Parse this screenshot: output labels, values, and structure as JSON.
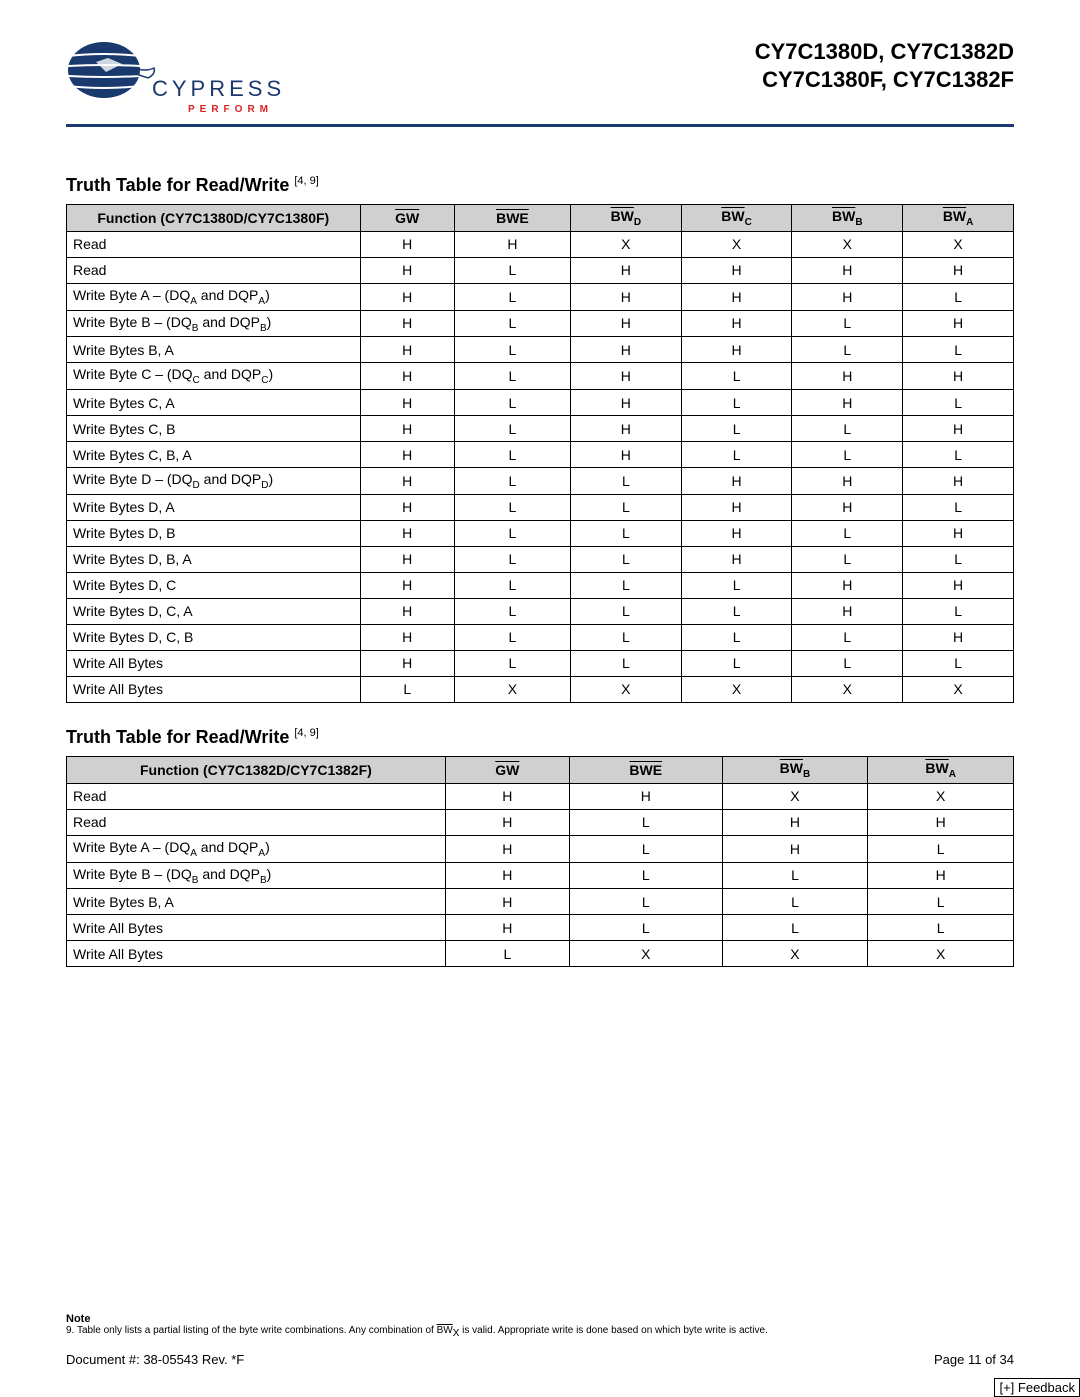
{
  "header": {
    "logo_text": "CYPRESS",
    "logo_tagline": "PERFORM",
    "part_line1": "CY7C1380D, CY7C1382D",
    "part_line2": "CY7C1380F, CY7C1382F"
  },
  "section1": {
    "title": "Truth Table for Read/Write ",
    "footnote_ref": "[4, 9]",
    "headers": {
      "function": "Function (CY7C1380D/CY7C1380F)",
      "gw": "GW",
      "bwe": "BWE",
      "bwd": "BW",
      "bwd_sub": "D",
      "bwc": "BW",
      "bwc_sub": "C",
      "bwb": "BW",
      "bwb_sub": "B",
      "bwa": "BW",
      "bwa_sub": "A"
    },
    "rows": [
      {
        "fn": "Read",
        "gw": "H",
        "bwe": "H",
        "bwd": "X",
        "bwc": "X",
        "bwb": "X",
        "bwa": "X",
        "fn_html": "Read"
      },
      {
        "fn": "Read",
        "gw": "H",
        "bwe": "L",
        "bwd": "H",
        "bwc": "H",
        "bwb": "H",
        "bwa": "H",
        "fn_html": "Read"
      },
      {
        "fn": "Write Byte A – (DQA and DQPA)",
        "gw": "H",
        "bwe": "L",
        "bwd": "H",
        "bwc": "H",
        "bwb": "H",
        "bwa": "L",
        "fn_html": "Write Byte A  – (DQ<sub>A</sub> and DQP<sub>A</sub>)"
      },
      {
        "fn": "Write Byte B – (DQB and DQPB)",
        "gw": "H",
        "bwe": "L",
        "bwd": "H",
        "bwc": "H",
        "bwb": "L",
        "bwa": "H",
        "fn_html": "Write Byte B – (DQ<sub>B</sub> and DQP<sub>B</sub>)"
      },
      {
        "fn": "Write Bytes B, A",
        "gw": "H",
        "bwe": "L",
        "bwd": "H",
        "bwc": "H",
        "bwb": "L",
        "bwa": "L",
        "fn_html": "Write Bytes B, A"
      },
      {
        "fn": "Write Byte C – (DQC and DQPC)",
        "gw": "H",
        "bwe": "L",
        "bwd": "H",
        "bwc": "L",
        "bwb": "H",
        "bwa": "H",
        "fn_html": "Write Byte C – (DQ<sub>C</sub> and DQP<sub>C</sub>)"
      },
      {
        "fn": "Write Bytes C, A",
        "gw": "H",
        "bwe": "L",
        "bwd": "H",
        "bwc": "L",
        "bwb": "H",
        "bwa": "L",
        "fn_html": "Write Bytes C, A"
      },
      {
        "fn": "Write Bytes C, B",
        "gw": "H",
        "bwe": "L",
        "bwd": "H",
        "bwc": "L",
        "bwb": "L",
        "bwa": "H",
        "fn_html": "Write Bytes C, B"
      },
      {
        "fn": "Write Bytes C, B, A",
        "gw": "H",
        "bwe": "L",
        "bwd": "H",
        "bwc": "L",
        "bwb": "L",
        "bwa": "L",
        "fn_html": "Write Bytes C, B, A"
      },
      {
        "fn": "Write Byte D – (DQD and DQPD)",
        "gw": "H",
        "bwe": "L",
        "bwd": "L",
        "bwc": "H",
        "bwb": "H",
        "bwa": "H",
        "fn_html": "Write Byte D – (DQ<sub>D</sub> and DQP<sub>D</sub>)"
      },
      {
        "fn": "Write Bytes D, A",
        "gw": "H",
        "bwe": "L",
        "bwd": "L",
        "bwc": "H",
        "bwb": "H",
        "bwa": "L",
        "fn_html": "Write Bytes D, A"
      },
      {
        "fn": "Write Bytes D, B",
        "gw": "H",
        "bwe": "L",
        "bwd": "L",
        "bwc": "H",
        "bwb": "L",
        "bwa": "H",
        "fn_html": "Write Bytes D, B"
      },
      {
        "fn": "Write Bytes D, B, A",
        "gw": "H",
        "bwe": "L",
        "bwd": "L",
        "bwc": "H",
        "bwb": "L",
        "bwa": "L",
        "fn_html": "Write Bytes D, B, A"
      },
      {
        "fn": "Write Bytes D, C",
        "gw": "H",
        "bwe": "L",
        "bwd": "L",
        "bwc": "L",
        "bwb": "H",
        "bwa": "H",
        "fn_html": "Write Bytes D, C"
      },
      {
        "fn": "Write Bytes D, C, A",
        "gw": "H",
        "bwe": "L",
        "bwd": "L",
        "bwc": "L",
        "bwb": "H",
        "bwa": "L",
        "fn_html": "Write Bytes D, C, A"
      },
      {
        "fn": "Write Bytes D, C, B",
        "gw": "H",
        "bwe": "L",
        "bwd": "L",
        "bwc": "L",
        "bwb": "L",
        "bwa": "H",
        "fn_html": "Write Bytes D, C, B"
      },
      {
        "fn": "Write All Bytes",
        "gw": "H",
        "bwe": "L",
        "bwd": "L",
        "bwc": "L",
        "bwb": "L",
        "bwa": "L",
        "fn_html": "Write All Bytes"
      },
      {
        "fn": "Write All Bytes",
        "gw": "L",
        "bwe": "X",
        "bwd": "X",
        "bwc": "X",
        "bwb": "X",
        "bwa": "X",
        "fn_html": "Write All Bytes"
      }
    ]
  },
  "section2": {
    "title": "Truth Table for Read/Write ",
    "footnote_ref": "[4, 9]",
    "headers": {
      "function": "Function (CY7C1382D/CY7C1382F)",
      "gw": "GW",
      "bwe": "BWE",
      "bwb": "BW",
      "bwb_sub": "B",
      "bwa": "BW",
      "bwa_sub": "A"
    },
    "rows": [
      {
        "fn": "Read",
        "gw": "H",
        "bwe": "H",
        "bwb": "X",
        "bwa": "X",
        "fn_html": "Read"
      },
      {
        "fn": "Read",
        "gw": "H",
        "bwe": "L",
        "bwb": "H",
        "bwa": "H",
        "fn_html": "Read"
      },
      {
        "fn": "Write Byte A – (DQA and DQPA)",
        "gw": "H",
        "bwe": "L",
        "bwb": "H",
        "bwa": "L",
        "fn_html": "Write Byte A  – (DQ<sub>A</sub> and DQP<sub>A</sub>)"
      },
      {
        "fn": "Write Byte B – (DQB and DQPB)",
        "gw": "H",
        "bwe": "L",
        "bwb": "L",
        "bwa": "H",
        "fn_html": "Write Byte B – (DQ<sub>B</sub> and DQP<sub>B</sub>)"
      },
      {
        "fn": "Write Bytes B, A",
        "gw": "H",
        "bwe": "L",
        "bwb": "L",
        "bwa": "L",
        "fn_html": "Write Bytes B, A"
      },
      {
        "fn": "Write All Bytes",
        "gw": "H",
        "bwe": "L",
        "bwb": "L",
        "bwa": "L",
        "fn_html": "Write All Bytes"
      },
      {
        "fn": "Write All Bytes",
        "gw": "L",
        "bwe": "X",
        "bwb": "X",
        "bwa": "X",
        "fn_html": "Write All Bytes"
      }
    ]
  },
  "note": {
    "title": "Note",
    "body_prefix": "9.  Table only lists a partial listing of the byte write combinations. Any combination of ",
    "body_bw": "BW",
    "body_sub": "X",
    "body_suffix": " is valid. Appropriate write is done based on which byte write is active."
  },
  "footer": {
    "doc": "Document #: 38-05543 Rev. *F",
    "page": "Page 11 of 34",
    "feedback": "[+] Feedback"
  }
}
